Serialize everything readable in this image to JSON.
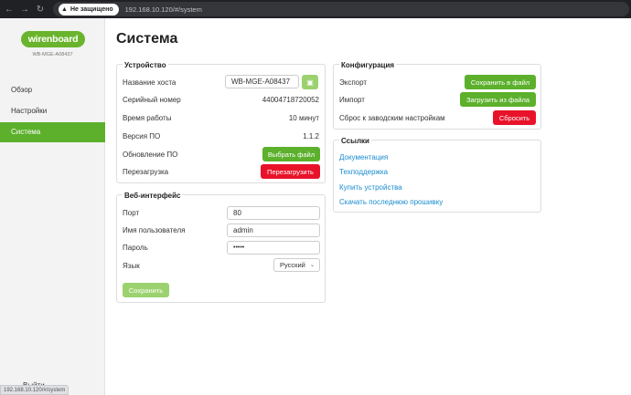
{
  "browser": {
    "back_icon": "arrow-left-icon",
    "forward_icon": "arrow-right-icon",
    "reload_icon": "reload-icon",
    "security_label": "Не защищено",
    "url": "192.168.10.120/#/system",
    "status_url": "192.168.10.120/#/system"
  },
  "sidebar": {
    "logo": "wirenboard",
    "serial": "WB-MGE-A08437",
    "items": [
      {
        "label": "Обзор",
        "active": false
      },
      {
        "label": "Настройки",
        "active": false
      },
      {
        "label": "Система",
        "active": true
      }
    ],
    "logout_label": "Выйти"
  },
  "page": {
    "title": "Система"
  },
  "device": {
    "title": "Устройство",
    "hostname_label": "Название хоста",
    "hostname_value": "WB-MGE-A08437",
    "serial_label": "Серийный номер",
    "serial_value": "44004718720052",
    "uptime_label": "Время работы",
    "uptime_value": "10 минут",
    "version_label": "Версия ПО",
    "version_value": "1.1.2",
    "update_label": "Обновление ПО",
    "update_button": "Выбрать файл",
    "reboot_label": "Перезагрузка",
    "reboot_button": "Перезагрузить"
  },
  "web": {
    "title": "Веб-интерфейс",
    "port_label": "Порт",
    "port_value": "80",
    "user_label": "Имя пользователя",
    "user_value": "admin",
    "password_label": "Пароль",
    "password_value": "•••••",
    "lang_label": "Язык",
    "lang_value": "Русский",
    "save_button": "Сохранить"
  },
  "config": {
    "title": "Конфигурация",
    "export_label": "Экспорт",
    "export_button": "Сохранить в файл",
    "import_label": "Импорт",
    "import_button": "Загрузить из файла",
    "reset_label": "Сброс к заводским настройкам",
    "reset_button": "Сбросить"
  },
  "links": {
    "title": "Ссылки",
    "items": [
      "Документация",
      "Техподдержка",
      "Купить устройства",
      "Скачать последнюю прошивку"
    ]
  },
  "colors": {
    "accent": "#5cb02c",
    "danger": "#e8132a",
    "link": "#1a8ccf"
  }
}
